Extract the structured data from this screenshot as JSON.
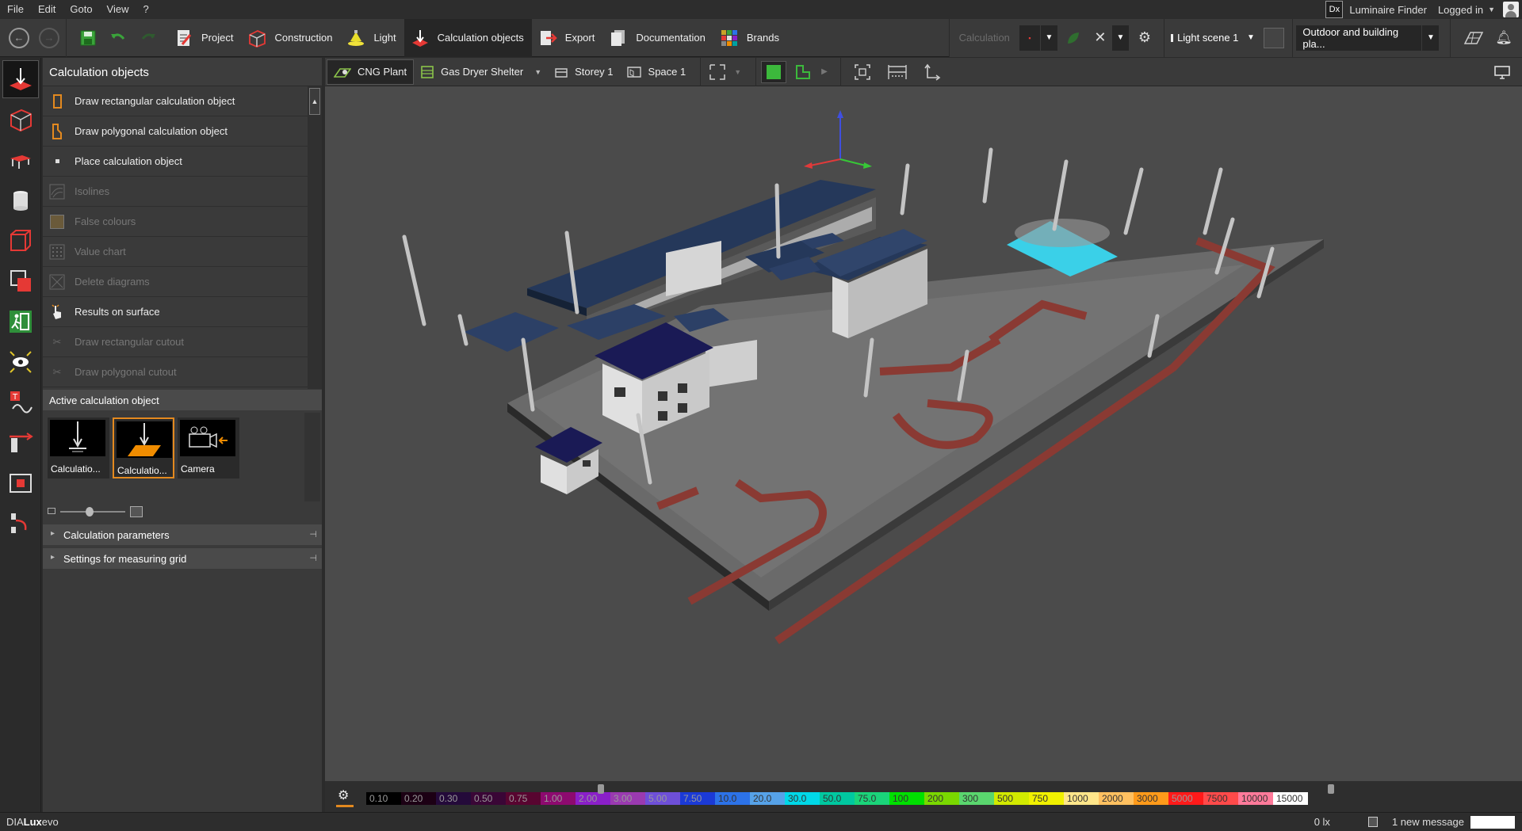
{
  "menu": {
    "file": "File",
    "edit": "Edit",
    "goto": "Goto",
    "view": "View",
    "help": "?"
  },
  "topright": {
    "logo": "Dx",
    "luminaire_finder": "Luminaire Finder",
    "logged_in": "Logged in"
  },
  "tabs": [
    {
      "label": "Project"
    },
    {
      "label": "Construction"
    },
    {
      "label": "Light"
    },
    {
      "label": "Calculation objects"
    },
    {
      "label": "Export"
    },
    {
      "label": "Documentation"
    },
    {
      "label": "Brands"
    }
  ],
  "calc": {
    "label": "Calculation",
    "light_scene": "Light scene 1",
    "planning": "Outdoor and building pla..."
  },
  "panel": {
    "title": "Calculation objects",
    "items": [
      {
        "label": "Draw rectangular calculation object"
      },
      {
        "label": "Draw polygonal calculation object"
      },
      {
        "label": "Place calculation object"
      },
      {
        "label": "Isolines"
      },
      {
        "label": "False colours"
      },
      {
        "label": "Value chart"
      },
      {
        "label": "Delete diagrams"
      },
      {
        "label": "Results on surface"
      },
      {
        "label": "Draw rectangular cutout"
      },
      {
        "label": "Draw polygonal cutout"
      }
    ],
    "active_header": "Active calculation object",
    "thumbs": [
      {
        "label": "Calculatio..."
      },
      {
        "label": "Calculatio..."
      },
      {
        "label": "Camera"
      }
    ],
    "acc1": "Calculation parameters",
    "acc2": "Settings for measuring grid"
  },
  "viewtool": {
    "project": "CNG Plant",
    "building": "Gas Dryer Shelter",
    "storey": "Storey 1",
    "space": "Space 1"
  },
  "legend": [
    {
      "v": "0.10",
      "c": "#000000"
    },
    {
      "v": "0.20",
      "c": "#1c0014"
    },
    {
      "v": "0.30",
      "c": "#240a3a"
    },
    {
      "v": "0.50",
      "c": "#3a0636"
    },
    {
      "v": "0.75",
      "c": "#580530"
    },
    {
      "v": "1.00",
      "c": "#8d0a6f"
    },
    {
      "v": "2.00",
      "c": "#8a1fc8"
    },
    {
      "v": "3.00",
      "c": "#9a3ab0"
    },
    {
      "v": "5.00",
      "c": "#6e4fd8"
    },
    {
      "v": "7.50",
      "c": "#1b3ad6"
    },
    {
      "v": "10.0",
      "c": "#2c72e8"
    },
    {
      "v": "20.0",
      "c": "#56a2e8"
    },
    {
      "v": "30.0",
      "c": "#00d8e8"
    },
    {
      "v": "50.0",
      "c": "#00c8a0"
    },
    {
      "v": "75.0",
      "c": "#1ad47a"
    },
    {
      "v": "100",
      "c": "#00e000"
    },
    {
      "v": "200",
      "c": "#7ad800"
    },
    {
      "v": "300",
      "c": "#5ad66e"
    },
    {
      "v": "500",
      "c": "#d2ea00"
    },
    {
      "v": "750",
      "c": "#f0f000"
    },
    {
      "v": "1000",
      "c": "#ffe68a"
    },
    {
      "v": "2000",
      "c": "#ffc060"
    },
    {
      "v": "3000",
      "c": "#ff9a1a"
    },
    {
      "v": "5000",
      "c": "#ff1a1a"
    },
    {
      "v": "7500",
      "c": "#ff4a4a"
    },
    {
      "v": "10000",
      "c": "#ff7a9a"
    },
    {
      "v": "15000",
      "c": "#ffffff"
    }
  ],
  "status": {
    "brand_a": "DIA",
    "brand_b": "Lux",
    "brand_c": "evo",
    "lux": "0 lx",
    "message": "1 new message"
  }
}
